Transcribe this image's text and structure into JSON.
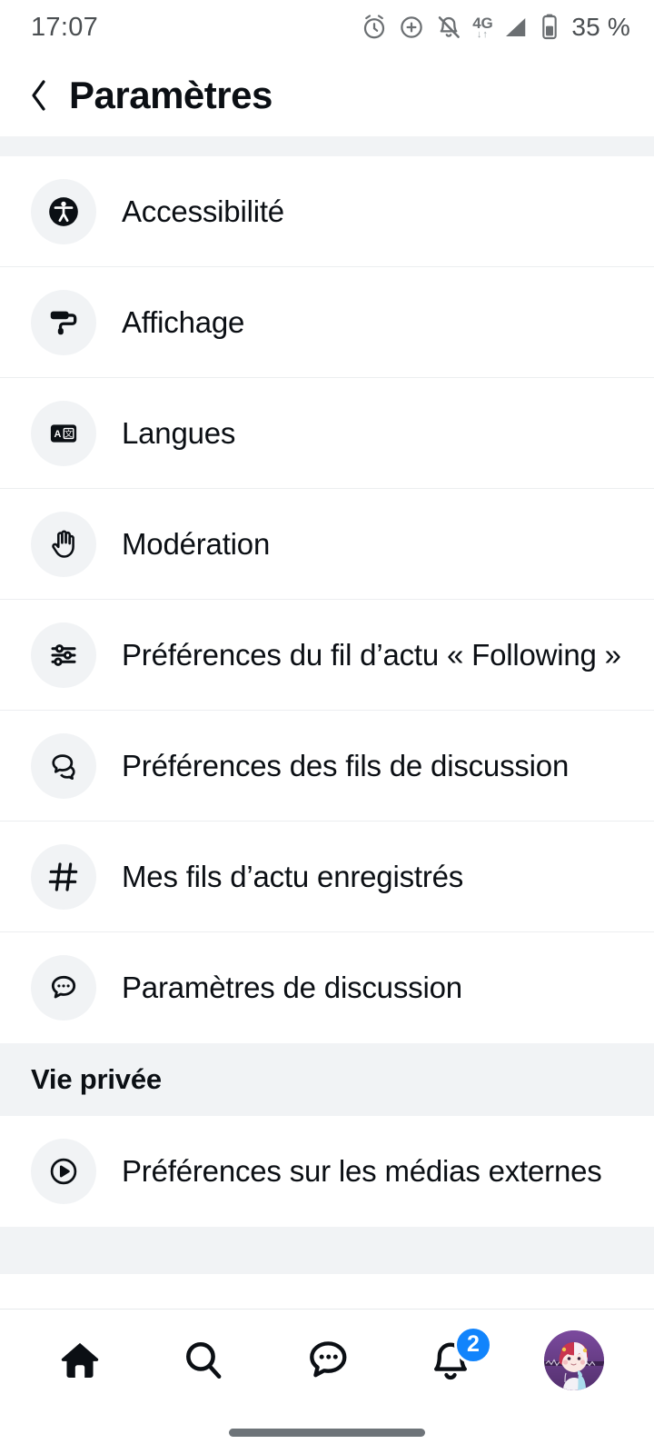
{
  "status_bar": {
    "time": "17:07",
    "battery_percent": "35 %",
    "network_type": "4G",
    "network_arrows": "↓↑",
    "icons": [
      "alarm-icon",
      "data-saver-icon",
      "notifications-muted-icon",
      "network-4g-icon",
      "signal-icon",
      "battery-icon"
    ]
  },
  "header": {
    "back_label": "‹",
    "title": "Paramètres"
  },
  "sections": [
    {
      "id": "clipped-top-section",
      "title": "",
      "clipped": "top"
    },
    {
      "id": "content-section",
      "title": "",
      "rows": [
        {
          "icon": "accessibility-icon",
          "label": "Accessibilité"
        },
        {
          "icon": "paint-roller-icon",
          "label": "Affichage"
        },
        {
          "icon": "translate-icon",
          "label": "Langues"
        },
        {
          "icon": "raised-hand-icon",
          "label": "Modération"
        },
        {
          "icon": "sliders-icon",
          "label": "Préférences du fil d’actu « Following »"
        },
        {
          "icon": "threads-bubbles-icon",
          "label": "Préférences des fils de discussion"
        },
        {
          "icon": "hashtag-icon",
          "label": "Mes fils d’actu enregistrés"
        },
        {
          "icon": "chat-dots-icon",
          "label": "Paramètres de discussion"
        }
      ]
    },
    {
      "id": "privacy-section",
      "title": "Vie privée",
      "rows": [
        {
          "icon": "play-circle-icon",
          "label": "Préférences sur les médias externes"
        }
      ]
    },
    {
      "id": "clipped-bottom-section",
      "title": "",
      "clipped": "bottom"
    }
  ],
  "bottom_nav": {
    "items": [
      {
        "icon": "home-icon",
        "label": "Accueil",
        "active": true,
        "badge": ""
      },
      {
        "icon": "search-icon",
        "label": "Recherche",
        "active": false,
        "badge": ""
      },
      {
        "icon": "chat-icon",
        "label": "Discussions",
        "active": false,
        "badge": ""
      },
      {
        "icon": "bell-icon",
        "label": "Notifications",
        "active": false,
        "badge": "2"
      },
      {
        "icon": "avatar-icon",
        "label": "Profil",
        "active": false,
        "badge": ""
      }
    ],
    "badge_color": "#1184fc"
  },
  "colors": {
    "background": "#ffffff",
    "section_band": "#f1f3f5",
    "icon_circle": "#f1f3f5",
    "text_primary": "#0b0f14",
    "divider": "#eceef0",
    "accent": "#1184fc"
  }
}
